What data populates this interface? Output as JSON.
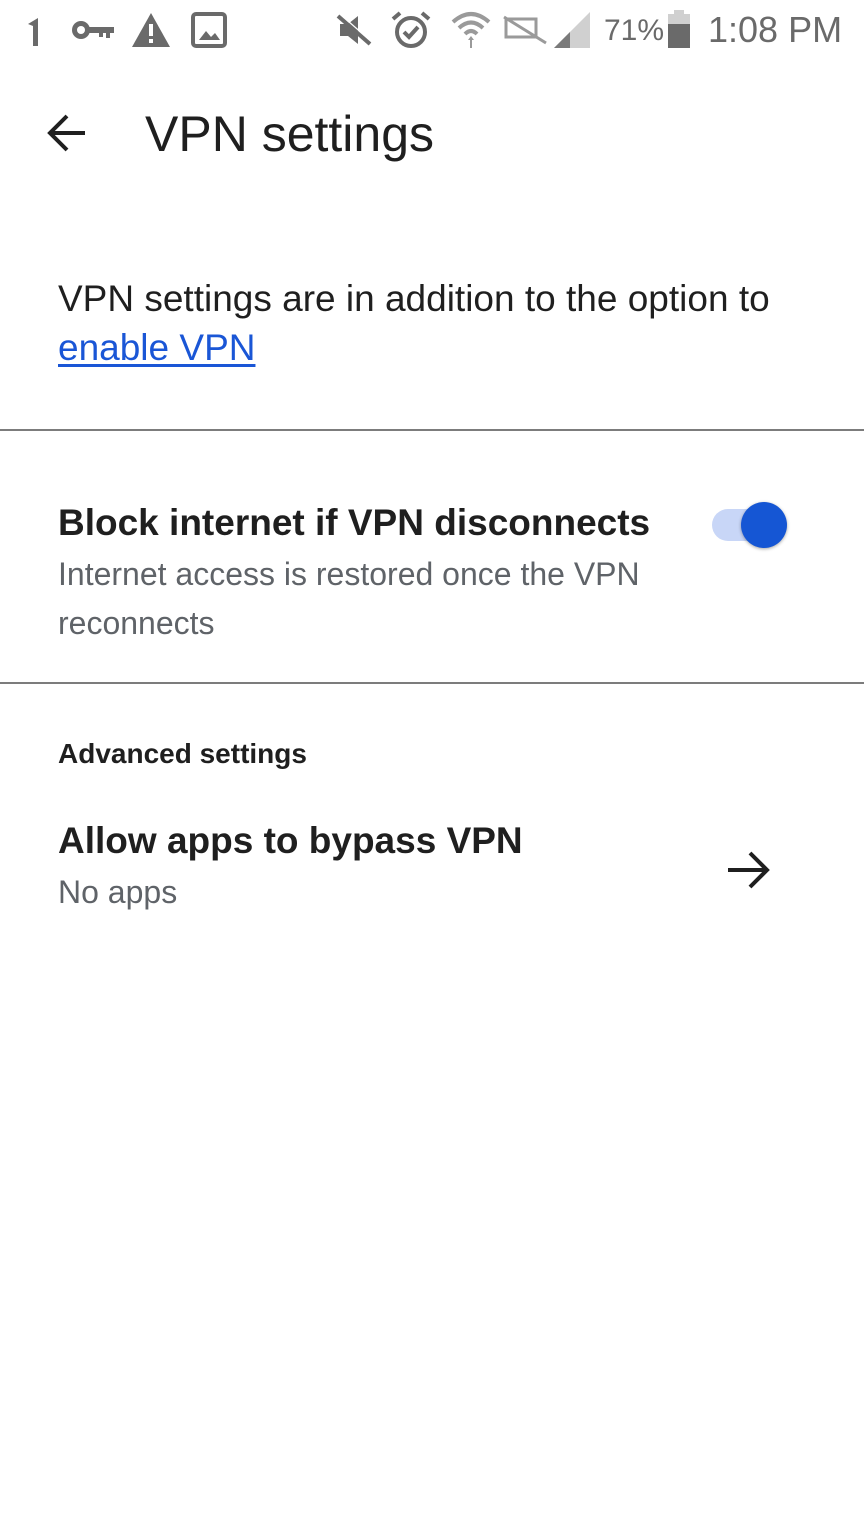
{
  "status_bar": {
    "battery_percent": "71%",
    "time": "1:08 PM",
    "icons": [
      "signal-bars-icon",
      "key-icon",
      "warning-icon",
      "image-icon",
      "vibrate-off-icon",
      "alarm-icon",
      "wifi-icon",
      "no-data-icon",
      "cell-signal-icon",
      "battery-icon"
    ]
  },
  "toolbar": {
    "back_icon": "back-arrow-icon",
    "title": "VPN settings"
  },
  "intro": {
    "text": "VPN settings are in addition to the option to ",
    "link_text": "enable VPN"
  },
  "block_internet": {
    "title": "Block internet if VPN disconnects",
    "summary": "Internet access is restored once the VPN reconnects",
    "enabled": true
  },
  "advanced": {
    "header": "Advanced settings",
    "bypass": {
      "title": "Allow apps to bypass VPN",
      "summary": "No apps",
      "icon": "forward-arrow-icon"
    }
  },
  "colors": {
    "accent": "#1556d4",
    "link": "#1a56d6",
    "toggle_track": "#c8d6f7",
    "divider": "#7c7c7c",
    "secondary_text": "#5f6368"
  }
}
